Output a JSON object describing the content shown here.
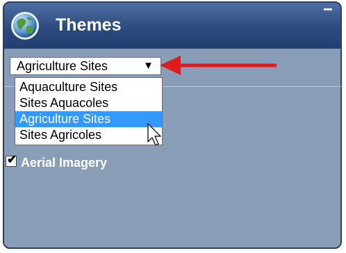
{
  "panel": {
    "title": "Themes",
    "globe_icon": "globe-icon",
    "minimize_icon": "minimize-icon",
    "header_color": "#2c4a7e",
    "body_color": "#8a9db6"
  },
  "theme_select": {
    "selected": "Agriculture Sites",
    "arrow": "▼",
    "options": [
      {
        "label": "Aquaculture Sites",
        "selected": false
      },
      {
        "label": "Sites Aquacoles",
        "selected": false
      },
      {
        "label": "Agriculture Sites",
        "selected": true
      },
      {
        "label": "Sites Agricoles",
        "selected": false
      }
    ],
    "highlight_color": "#3399ff"
  },
  "layers": [
    {
      "label": "Aerial Imagery",
      "checked": true
    }
  ],
  "annotation": {
    "arrow_color": "#e11b1b"
  }
}
